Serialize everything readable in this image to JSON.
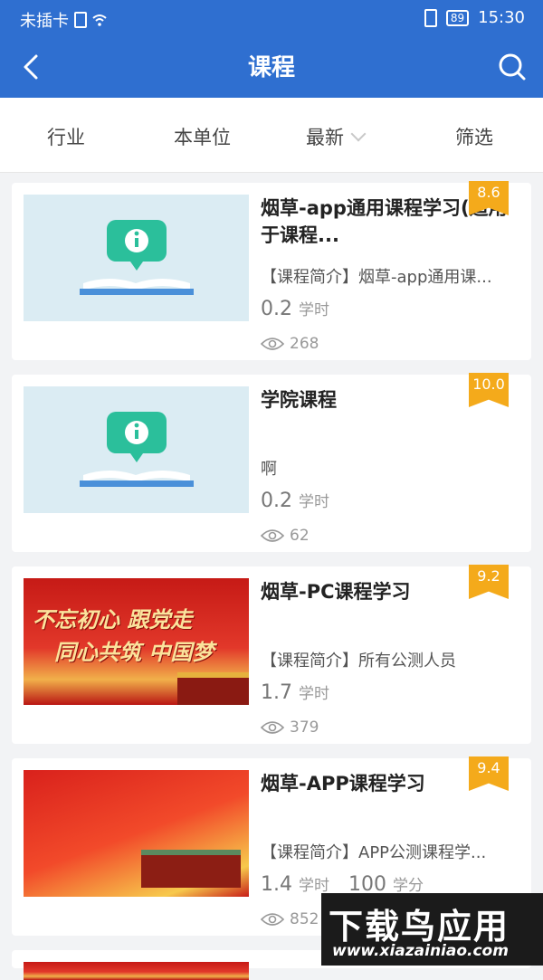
{
  "status": {
    "carrier": "未插卡",
    "battery": "89",
    "time": "15:30"
  },
  "nav": {
    "title": "课程"
  },
  "filters": [
    "行业",
    "本单位",
    "最新",
    "筛选"
  ],
  "courses": [
    {
      "title": "烟草-app通用课程学习(适用于课程...",
      "intro": "【课程简介】烟草-app通用课...",
      "hours": "0.2",
      "hours_unit": "学时",
      "views": "268",
      "score": "8.6"
    },
    {
      "title": "学院课程",
      "intro": "啊",
      "hours": "0.2",
      "hours_unit": "学时",
      "views": "62",
      "score": "10.0"
    },
    {
      "title": "烟草-PC课程学习",
      "intro": "【课程简介】所有公测人员",
      "hours": "1.7",
      "hours_unit": "学时",
      "views": "379",
      "score": "9.2",
      "banner_line1": "不忘初心 跟党走",
      "banner_line2": "同心共筑 中国梦"
    },
    {
      "title": "烟草-APP课程学习",
      "intro": "【课程简介】APP公测课程学...",
      "hours": "1.4",
      "hours_unit": "学时",
      "credits": "100",
      "credits_unit": "学分",
      "views": "852",
      "score": "9.4"
    }
  ],
  "watermark": {
    "title": "下载鸟应用",
    "url": "www.xiazainiao.com"
  }
}
